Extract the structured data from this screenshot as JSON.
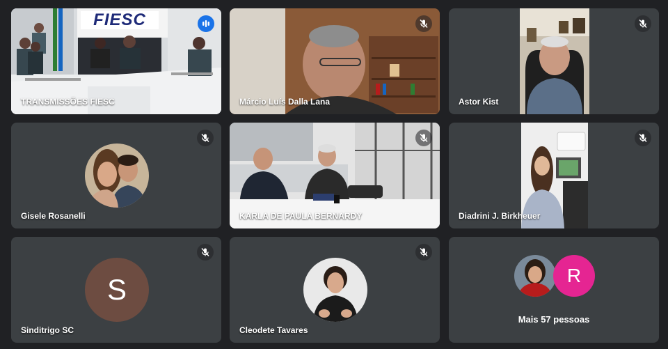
{
  "meeting": {
    "tiles": [
      {
        "name": "TRANSMISSÕES FIESC",
        "banner": "FIESC",
        "speaking": true
      },
      {
        "name": "Márcio Luís Dalla Lana",
        "muted": true
      },
      {
        "name": "Astor Kist",
        "muted": true
      },
      {
        "name": "Gisele Rosanelli",
        "muted": true
      },
      {
        "name": "KARLA DE PAULA BERNARDY",
        "muted": true
      },
      {
        "name": "Diadrini J. Birkheuer",
        "muted": true
      },
      {
        "name": "Sinditrigo SC",
        "avatar_letter": "S",
        "avatar_color": "#6d4c41",
        "muted": true
      },
      {
        "name": "Cleodete Tavares",
        "muted": true
      }
    ],
    "more": {
      "label": "Mais 57 pessoas",
      "avatar_letter": "R",
      "avatar_color": "#e52592"
    }
  },
  "colors": {
    "background": "#202124",
    "tile": "#3c4043",
    "active_speaker_border": "#8ab4f8",
    "speaking_indicator": "#1a73e8"
  },
  "icons": [
    "mic-off-icon",
    "speaking-indicator-icon"
  ]
}
